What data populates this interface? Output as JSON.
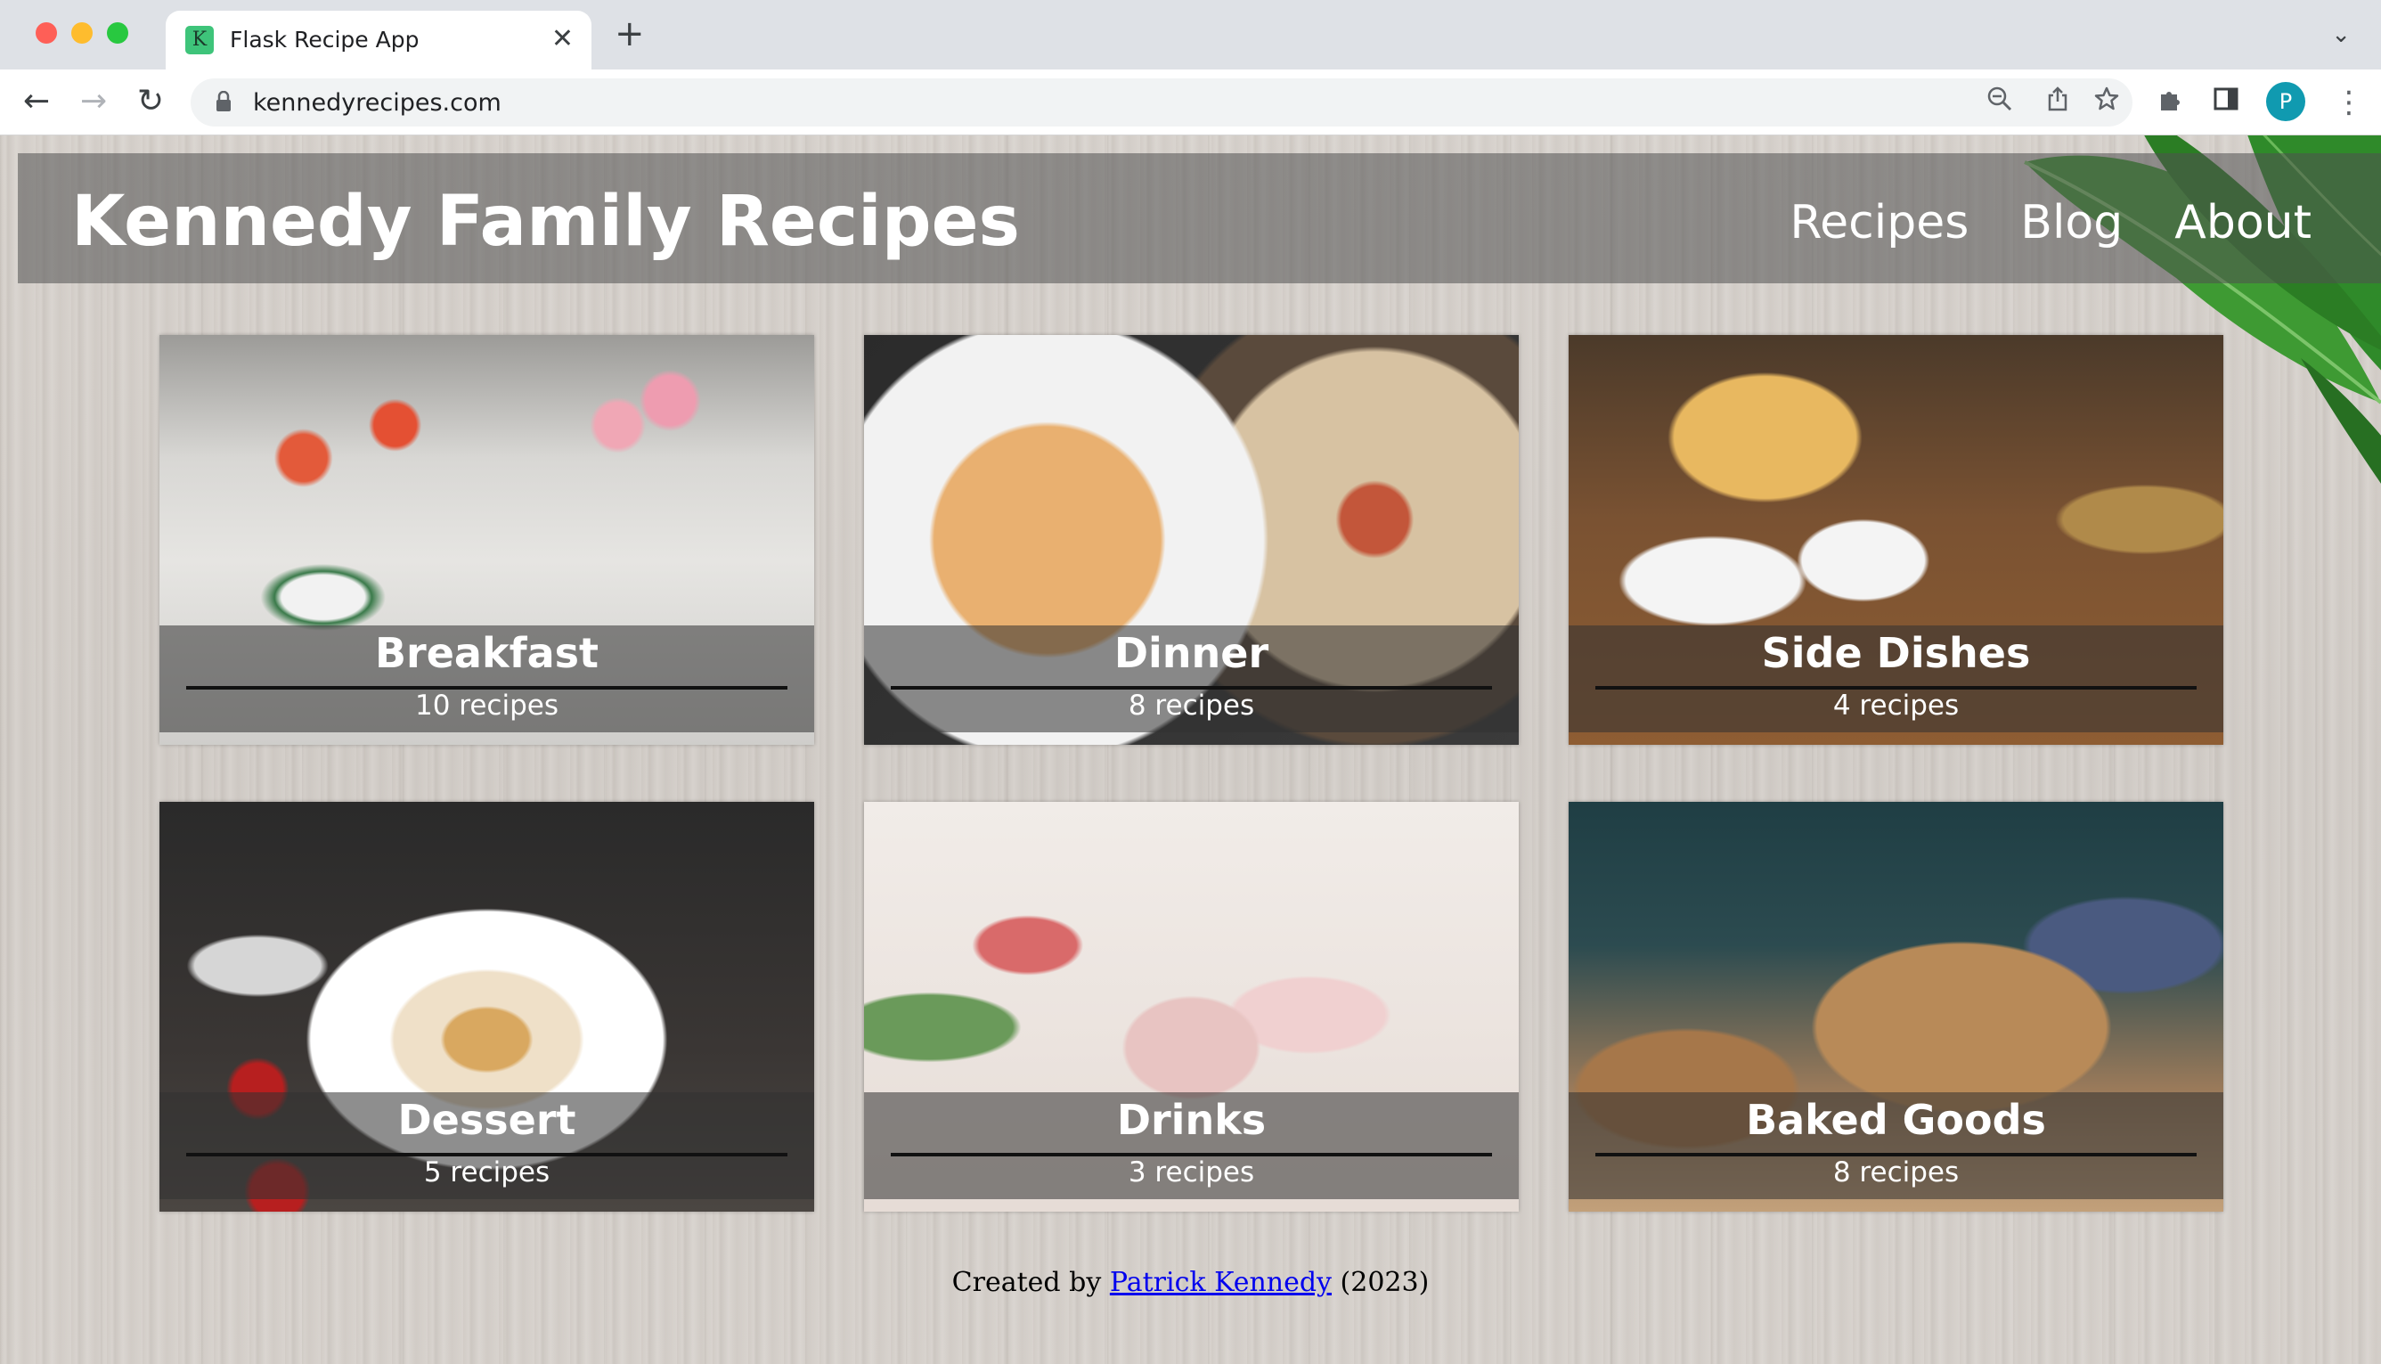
{
  "browser": {
    "tab": {
      "favicon_letter": "K",
      "title": "Flask Recipe App",
      "close_glyph": "✕"
    },
    "new_tab_glyph": "+",
    "tab_menu_glyph": "⌄",
    "nav": {
      "back": "←",
      "forward": "→",
      "reload": "↻"
    },
    "url": "kennedyrecipes.com",
    "lock_glyph": "🔒",
    "omnibox_icons": {
      "zoom": "⊖",
      "share": "⇪",
      "bookmark": "☆"
    },
    "toolbar_icons": {
      "extensions": "✱",
      "side_panel": "▣",
      "more": "⋮"
    },
    "profile_initial": "P"
  },
  "site": {
    "title": "Kennedy Family Recipes",
    "nav": [
      {
        "label": "Recipes"
      },
      {
        "label": "Blog"
      },
      {
        "label": "About"
      }
    ]
  },
  "categories": [
    {
      "name": "Breakfast",
      "count": "10 recipes"
    },
    {
      "name": "Dinner",
      "count": "8 recipes"
    },
    {
      "name": "Side Dishes",
      "count": "4 recipes"
    },
    {
      "name": "Dessert",
      "count": "5 recipes"
    },
    {
      "name": "Drinks",
      "count": "3 recipes"
    },
    {
      "name": "Baked Goods",
      "count": "8 recipes"
    }
  ],
  "footer": {
    "prefix": "Created by",
    "author_link": "Patrick Kennedy",
    "suffix": "(2023)"
  }
}
